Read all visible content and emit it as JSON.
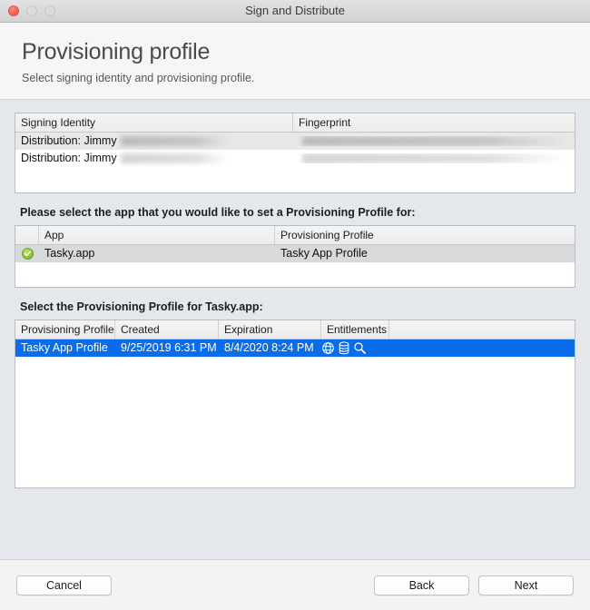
{
  "window": {
    "title": "Sign and Distribute",
    "traffic_lights": [
      "close-button",
      "minimize-button",
      "maximize-button"
    ],
    "accent_selection": "#0a6ce8",
    "accent_check": "#8dc63f"
  },
  "header": {
    "title": "Provisioning profile",
    "subtitle": "Select signing identity and provisioning profile."
  },
  "signing_table": {
    "columns": [
      "Signing Identity",
      "Fingerprint"
    ],
    "rows": [
      {
        "identity": "Distribution: Jimmy",
        "identity_redacted": true,
        "fingerprint": "",
        "fingerprint_redacted": true
      },
      {
        "identity": "Distribution: Jimmy",
        "identity_redacted": true,
        "fingerprint": "",
        "fingerprint_redacted": true
      }
    ]
  },
  "app_section": {
    "label": "Please select the app that you would like to set a Provisioning Profile for:",
    "columns": [
      "",
      "App",
      "Provisioning Profile"
    ],
    "rows": [
      {
        "status": "check-icon",
        "app": "Tasky.app",
        "profile": "Tasky App Profile",
        "selected": true
      }
    ]
  },
  "profile_section": {
    "label": "Select the Provisioning Profile for Tasky.app:",
    "columns": [
      "Provisioning Profile",
      "Created",
      "Expiration",
      "Entitlements",
      ""
    ],
    "rows": [
      {
        "profile": "Tasky App Profile",
        "created": "9/25/2019 6:31 PM",
        "expiration": "8/4/2020 8:24 PM",
        "entitlements": [
          "globe-icon",
          "database-icon",
          "magnifier-icon"
        ],
        "selected": true
      }
    ]
  },
  "footer": {
    "cancel_label": "Cancel",
    "back_label": "Back",
    "next_label": "Next"
  }
}
